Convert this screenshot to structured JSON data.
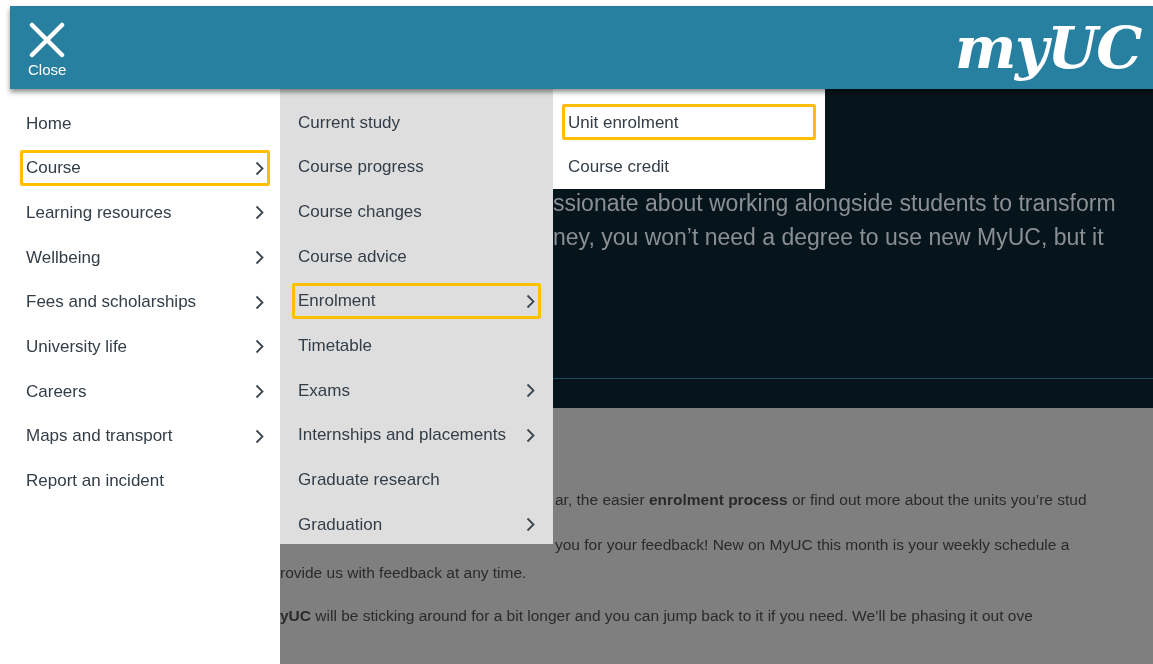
{
  "header": {
    "close_label": "Close",
    "logo": "myUC"
  },
  "main_menu": [
    {
      "label": "Home",
      "has_submenu": false,
      "selected": false
    },
    {
      "label": "Course",
      "has_submenu": true,
      "selected": true
    },
    {
      "label": "Learning resources",
      "has_submenu": true,
      "selected": false
    },
    {
      "label": "Wellbeing",
      "has_submenu": true,
      "selected": false
    },
    {
      "label": "Fees and scholarships",
      "has_submenu": true,
      "selected": false
    },
    {
      "label": "University life",
      "has_submenu": true,
      "selected": false
    },
    {
      "label": "Careers",
      "has_submenu": true,
      "selected": false
    },
    {
      "label": "Maps and transport",
      "has_submenu": true,
      "selected": false
    },
    {
      "label": "Report an incident",
      "has_submenu": false,
      "selected": false
    }
  ],
  "course_menu": [
    {
      "label": "Current study",
      "has_submenu": false,
      "selected": false
    },
    {
      "label": "Course progress",
      "has_submenu": false,
      "selected": false
    },
    {
      "label": "Course changes",
      "has_submenu": false,
      "selected": false
    },
    {
      "label": "Course advice",
      "has_submenu": false,
      "selected": false
    },
    {
      "label": "Enrolment",
      "has_submenu": true,
      "selected": true
    },
    {
      "label": "Timetable",
      "has_submenu": false,
      "selected": false
    },
    {
      "label": "Exams",
      "has_submenu": true,
      "selected": false
    },
    {
      "label": "Internships and placements",
      "has_submenu": true,
      "selected": false
    },
    {
      "label": "Graduate research",
      "has_submenu": false,
      "selected": false
    },
    {
      "label": "Graduation",
      "has_submenu": true,
      "selected": false
    }
  ],
  "enrolment_menu": [
    {
      "label": "Unit enrolment",
      "selected": true
    },
    {
      "label": "Course credit",
      "selected": false
    }
  ],
  "hero_lines": [
    "ssionate about working alongside students to transform",
    "ney, you won’t need a degree to use new MyUC, but it"
  ],
  "paragraphs": [
    {
      "text": "ar, the easier **enrolment process** or find out more about the units you’re stud",
      "indent": true
    },
    {
      "text": "you for your feedback! New on MyUC this month is your weekly schedule a",
      "indent": true
    },
    {
      "text": "rovide us with feedback at any time.",
      "indent": false
    },
    {
      "text": "**yUC** will be sticking around for a bit longer and you can jump back to it if you need. We’ll be phasing it out ove",
      "indent": false
    }
  ]
}
